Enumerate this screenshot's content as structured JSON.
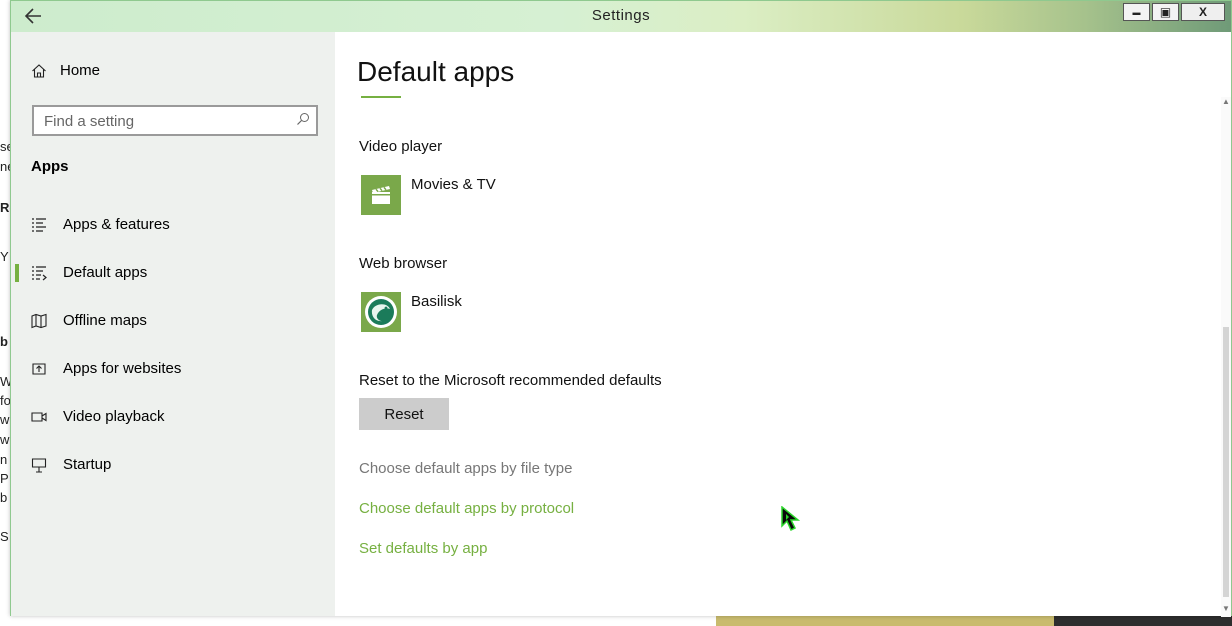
{
  "window": {
    "title": "Settings",
    "controls": {
      "minimize": "▬",
      "maximize": "▣",
      "close": "X"
    }
  },
  "sidebar": {
    "home_label": "Home",
    "search_placeholder": "Find a setting",
    "section_title": "Apps",
    "items": [
      {
        "label": "Apps & features",
        "icon": "list-icon"
      },
      {
        "label": "Default apps",
        "icon": "default-apps-icon",
        "active": true
      },
      {
        "label": "Offline maps",
        "icon": "map-icon"
      },
      {
        "label": "Apps for websites",
        "icon": "web-link-icon"
      },
      {
        "label": "Video playback",
        "icon": "video-icon"
      },
      {
        "label": "Startup",
        "icon": "startup-icon"
      }
    ]
  },
  "main": {
    "page_title": "Default apps",
    "video_player": {
      "label": "Video player",
      "app": "Movies & TV"
    },
    "web_browser": {
      "label": "Web browser",
      "app": "Basilisk"
    },
    "reset": {
      "label": "Reset to the Microsoft recommended defaults",
      "button": "Reset"
    },
    "links": {
      "by_file_type": "Choose default apps by file type",
      "by_protocol": "Choose default apps by protocol",
      "by_app": "Set defaults by app"
    }
  },
  "background_text": [
    "se",
    "ne",
    "Re",
    "Y",
    "b",
    "W",
    "fo",
    "w",
    "w",
    "n",
    "P",
    "b",
    "S"
  ],
  "colors": {
    "accent": "#76b041",
    "sidebar_bg": "#eef1ee",
    "button_bg": "#cccccc"
  }
}
